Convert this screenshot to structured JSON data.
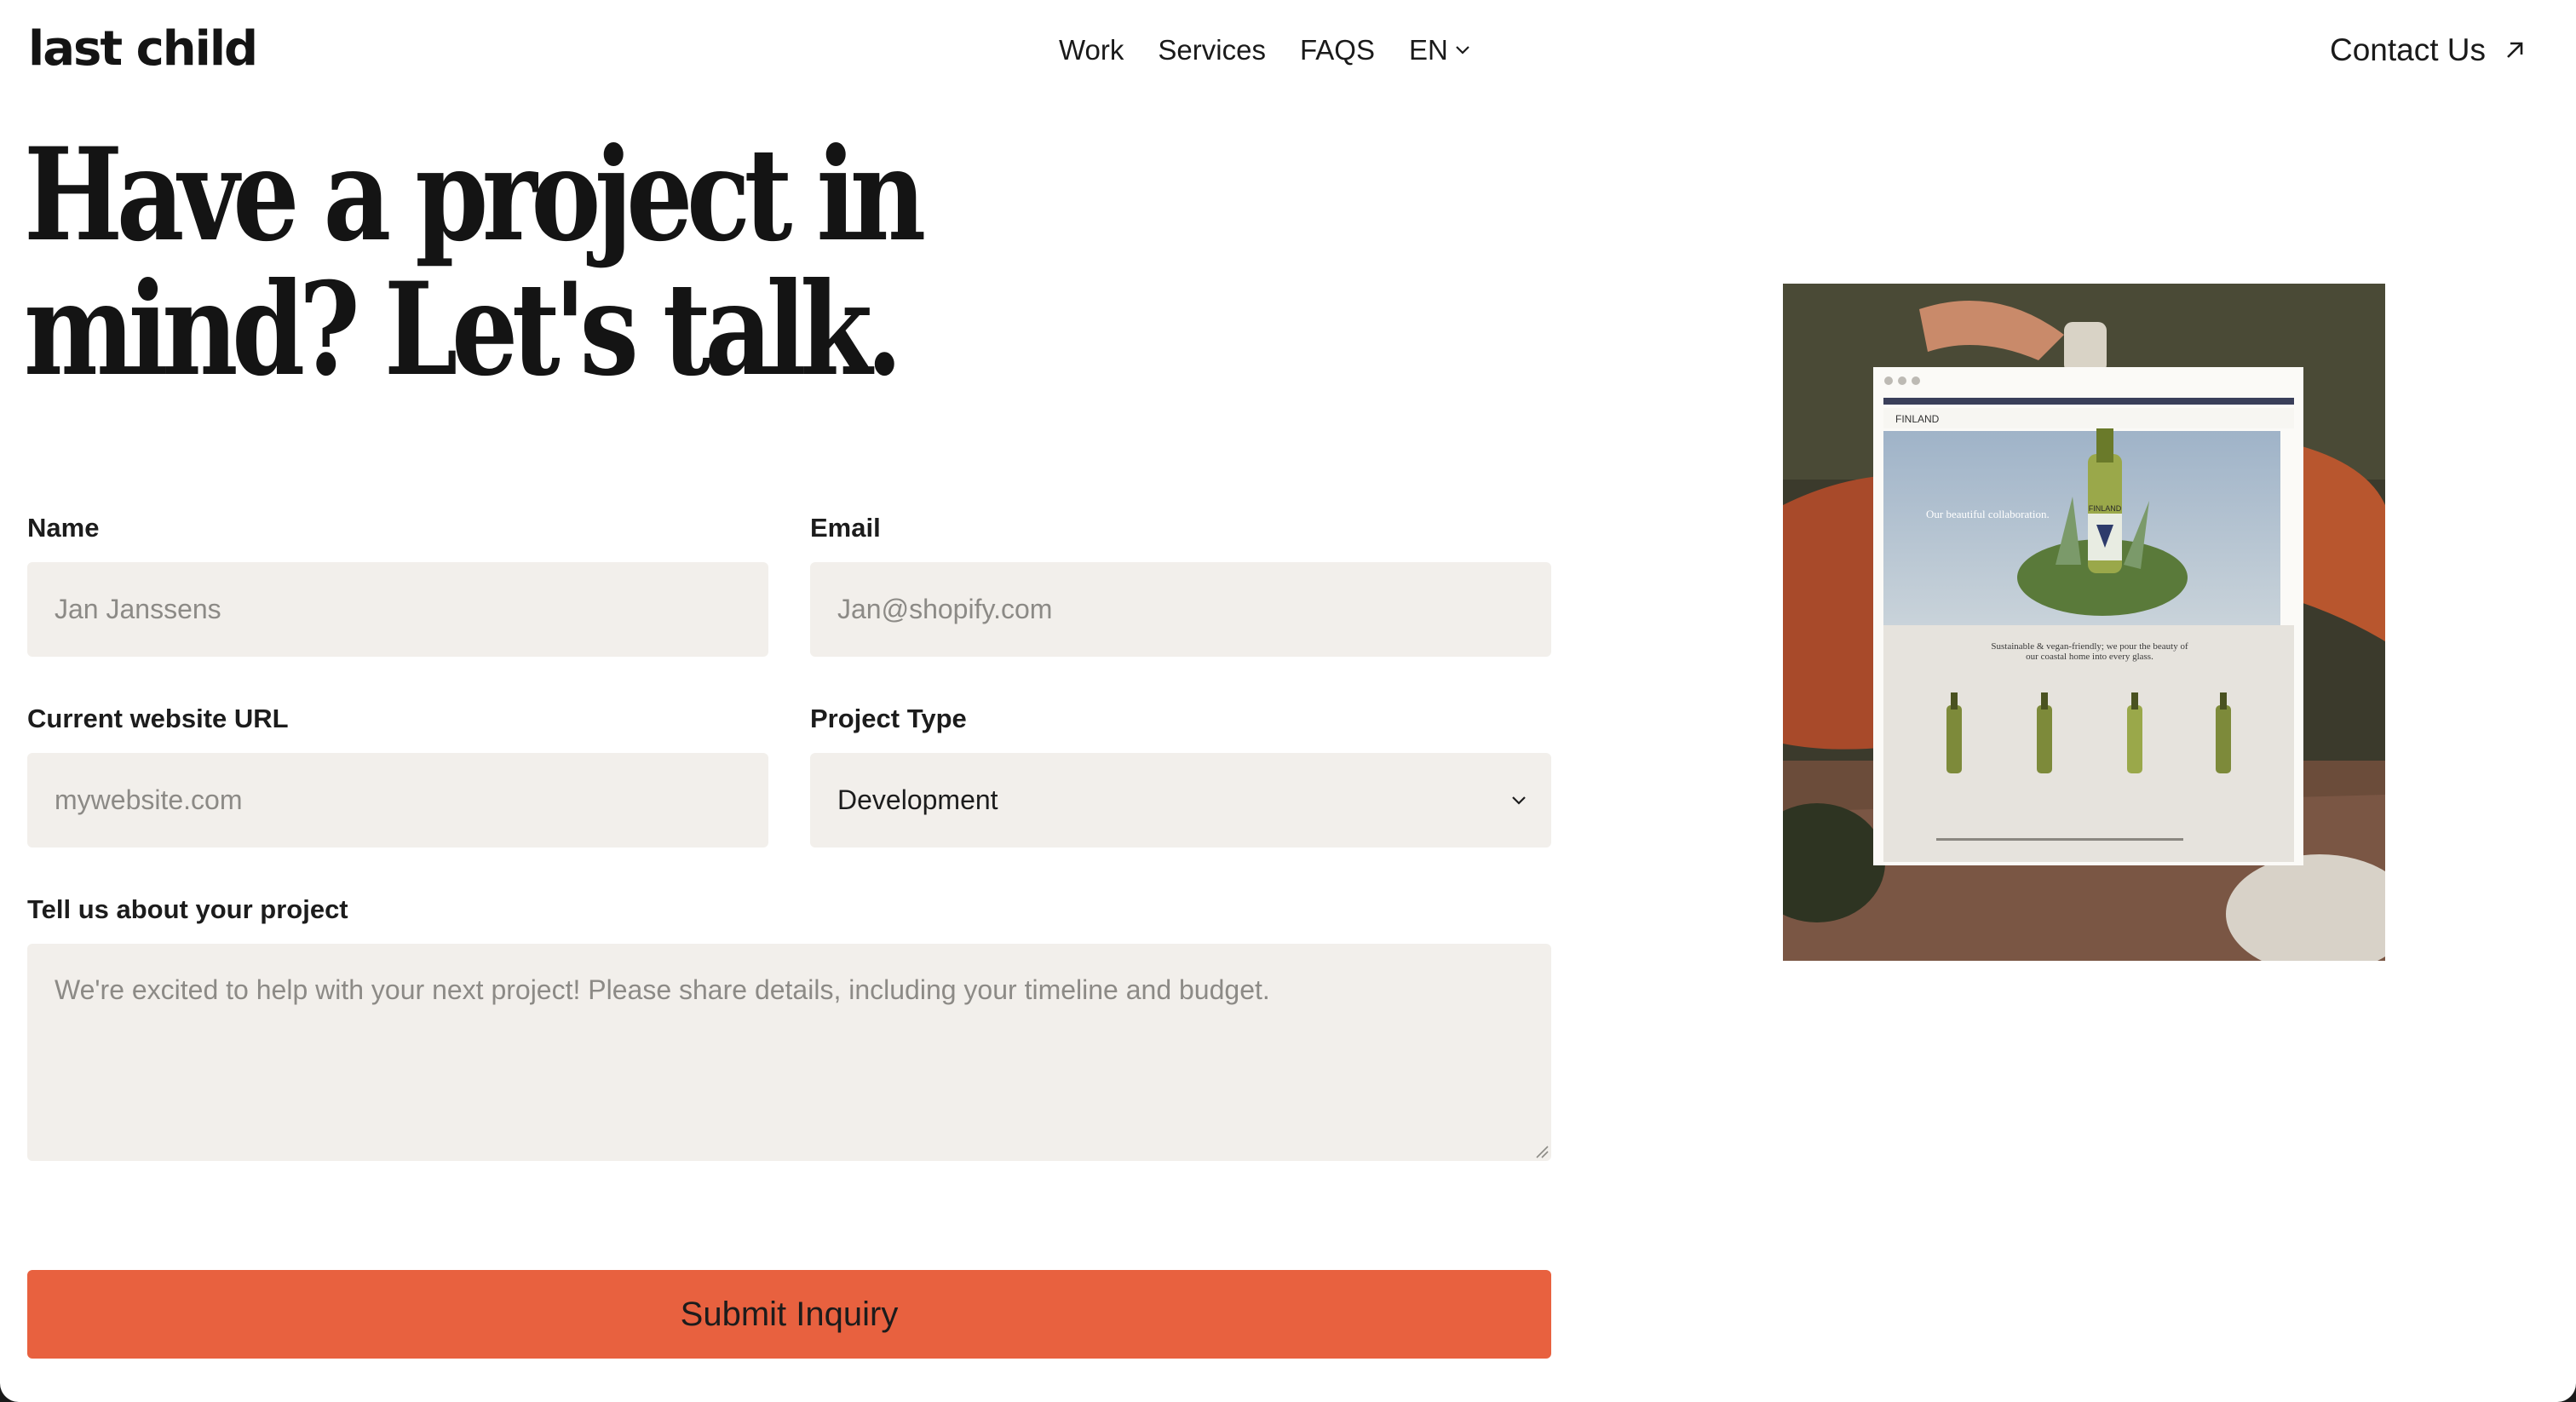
{
  "header": {
    "logo": "last child",
    "nav": [
      "Work",
      "Services",
      "FAQS"
    ],
    "language": "EN",
    "contact_label": "Contact Us"
  },
  "headline": {
    "line1": "Have a project in",
    "line2": "mind? Let's talk."
  },
  "form": {
    "name_label": "Name",
    "name_placeholder": "Jan Janssens",
    "email_label": "Email",
    "email_placeholder": "Jan@shopify.com",
    "url_label": "Current website URL",
    "url_placeholder": "mywebsite.com",
    "type_label": "Project Type",
    "type_value": "Development",
    "message_label": "Tell us about your project",
    "message_placeholder": "We're excited to help with your next project! Please share details, including your timeline and budget.",
    "submit_label": "Submit Inquiry"
  },
  "showcase": {
    "brand": "FINLAND",
    "hero_text": "Our beautiful collaboration.",
    "tagline": "Sustainable & vegan-friendly; we pour the beauty of our coastal home into every glass.",
    "bottle_label": "FINLAND"
  },
  "colors": {
    "accent": "#e8613f",
    "field_bg": "#f2efeb",
    "text": "#1a1a1a"
  }
}
